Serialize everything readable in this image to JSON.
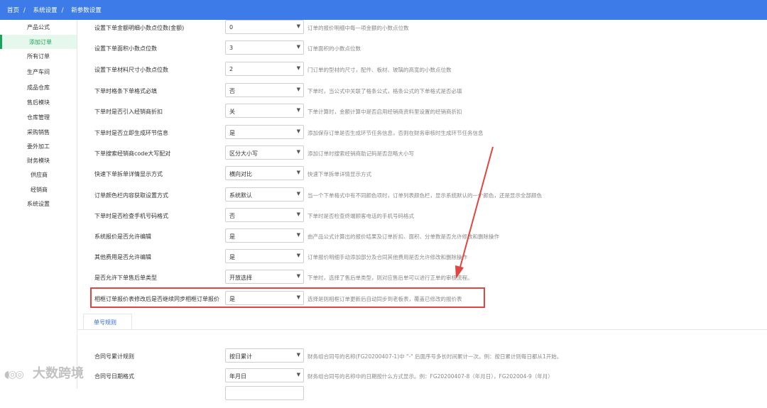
{
  "breadcrumb": [
    "首页",
    "系统设置",
    "新参数设置"
  ],
  "breadcrumb_sep": "/",
  "sidebar": {
    "items": [
      {
        "label": "产品公式",
        "active": false
      },
      {
        "label": "添加订单",
        "active": true
      },
      {
        "label": "所有订单",
        "active": false
      },
      {
        "label": "生产车间",
        "active": false
      },
      {
        "label": "成品仓库",
        "active": false
      },
      {
        "label": "售后模块",
        "active": false
      },
      {
        "label": "仓库管理",
        "active": false
      },
      {
        "label": "采购销售",
        "active": false
      },
      {
        "label": "委外加工",
        "active": false
      },
      {
        "label": "财务模块",
        "active": false
      },
      {
        "label": "供应商",
        "active": false
      },
      {
        "label": "经销商",
        "active": false
      },
      {
        "label": "系统设置",
        "active": false
      }
    ]
  },
  "settings": [
    {
      "label": "设置下单金额明细小数点位数(金额)",
      "value": "0",
      "desc": "订单的报价明细中每一项金额的小数点位数"
    },
    {
      "label": "设置下单面积小数点位数",
      "value": "3",
      "desc": "订单面积的小数点位数"
    },
    {
      "label": "设置下单材料尺寸小数点位数",
      "value": "2",
      "desc": "门订单的型材的尺寸，配件、板材、玻璃的高宽的小数点位数"
    },
    {
      "label": "下单时格条下单格式必填",
      "value": "否",
      "desc": "下单时，当公式中关联了格条公式，格条公式的下单格式是否必填"
    },
    {
      "label": "下单时是否引入经销商折扣",
      "value": "关",
      "desc": "下单计算时，金额计算中是否启用经销商资料里设置的经销商折扣"
    },
    {
      "label": "下单时是否立即生成环节信息",
      "value": "是",
      "desc": "添加保存订单是否生成环节任务信息，否则在财务审核时生成环节任务信息"
    },
    {
      "label": "下单搜索经销商code大写配对",
      "value": "区分大小写",
      "desc": "添加订单时搜索经销商助记码是否忽略大小写"
    },
    {
      "label": "快速下单拆单详情显示方式",
      "value": "横向对比",
      "desc": "快速下单拆单详情显示方式"
    },
    {
      "label": "订单颜色栏内容获取设置方式",
      "value": "系统默认",
      "desc": "当一个下单格式中有不同颜色项时，订单列表颜色栏，显示系统默认的一个颜色，还是显示全部颜色"
    },
    {
      "label": "下单时是否检查手机号码格式",
      "value": "否",
      "desc": "下单时是否检查终端顾客电话的手机号码格式"
    },
    {
      "label": "系统报价是否允许编辑",
      "value": "是",
      "desc": "由产品公式计算出的报价结果及订单折扣、面积、分单数是否允许修改和删除操作"
    },
    {
      "label": "其他费用是否允许编辑",
      "value": "是",
      "desc": "订单报价明细手动添加部分及合同其他费用是否允许修改和删除操作"
    },
    {
      "label": "是否允许下单售后单类型",
      "value": "开放选择",
      "desc": "下单时，选择了售后单类型，则对应售后单可以进行正单的审核流程。"
    },
    {
      "label": "相框订单报价表修改后是否继续同步相框订单报价",
      "value": "是",
      "desc": "选择是则相框订单更新后自动同步到老板表，覆盖已修改的报价表"
    }
  ],
  "tab": {
    "label": "单号规则"
  },
  "rules": [
    {
      "label": "合同号累计规则",
      "value": "按日累计",
      "desc": "财务组合同号的名称(FG20200407-1)中 \"-\" 后面序号多长时间累计一次。例：按日累计则每日都从1开始。"
    },
    {
      "label": "合同号日期格式",
      "value": "年月日",
      "desc": "财务组合同号的名称中的日期按什么方式显示。例：FG20200407-8（年月日），FG202004-9（年月）"
    }
  ],
  "watermark": "大数跨境",
  "colors": {
    "topbar": "#3d7be8",
    "active": "#1aa35a",
    "highlight": "#e0463f",
    "arrow": "#e0463f"
  }
}
